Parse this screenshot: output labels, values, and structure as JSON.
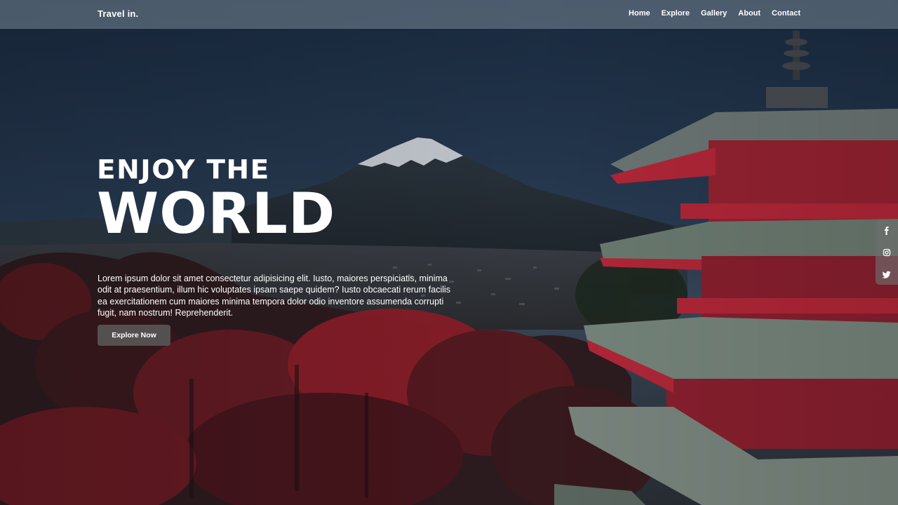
{
  "brand": "Travel in.",
  "nav": {
    "home": "Home",
    "explore": "Explore",
    "gallery": "Gallery",
    "about": "About",
    "contact": "Contact"
  },
  "hero": {
    "line1": "ENJOY THE",
    "line2": "WORLD",
    "paragraph": "Lorem ipsum dolor sit amet consectetur adipisicing elit. Iusto, maiores perspiciatis, minima odit at praesentium, illum hic voluptates ipsam saepe quidem? Iusto obcaecati rerum facilis ea exercitationem cum maiores minima tempora dolor odio inventore assumenda corrupti fugit, nam nostrum! Reprehenderit.",
    "button": "Explore Now"
  },
  "social": [
    "facebook-icon",
    "instagram-icon",
    "twitter-icon"
  ],
  "colors": {
    "sky": "#1f3450",
    "pagoda_red": "#b8283a",
    "foliage_red": "#8e1f2a",
    "roof": "#6f7f74"
  }
}
